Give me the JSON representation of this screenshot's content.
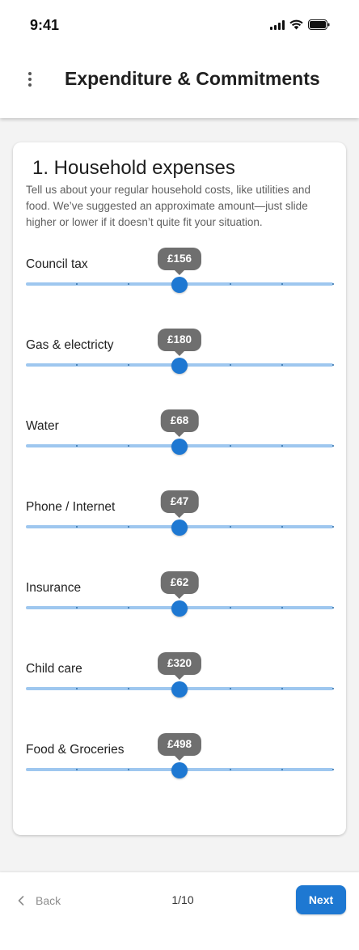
{
  "status_bar": {
    "time": "9:41"
  },
  "header": {
    "title": "Expenditure & Commitments"
  },
  "section": {
    "title": "1. Household expenses",
    "description": "Tell us about your regular household costs, like utilities and food. We’ve suggested an approximate amount—just slide higher or lower if it doesn’t quite fit your situation."
  },
  "sliders": [
    {
      "label": "Council tax",
      "value": "£156",
      "position": 0.5
    },
    {
      "label": "Gas & electricty",
      "value": "£180",
      "position": 0.5
    },
    {
      "label": "Water",
      "value": "£68",
      "position": 0.5
    },
    {
      "label": "Phone / Internet",
      "value": "£47",
      "position": 0.5
    },
    {
      "label": "Insurance",
      "value": "£62",
      "position": 0.5
    },
    {
      "label": "Child care",
      "value": "£320",
      "position": 0.5
    },
    {
      "label": "Food & Groceries",
      "value": "£498",
      "position": 0.5
    }
  ],
  "footer": {
    "back_label": "Back",
    "page_indicator": "1/10",
    "next_label": "Next"
  },
  "colors": {
    "accent": "#1e78d2",
    "track": "#9ec7ef",
    "tooltip": "#6f6f6f"
  }
}
